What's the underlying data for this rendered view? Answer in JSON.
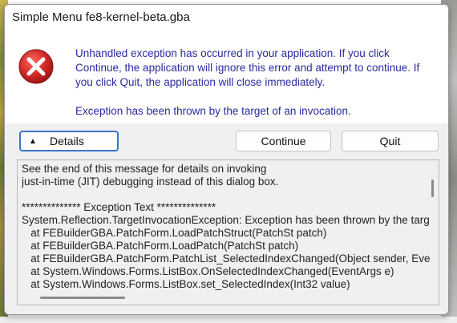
{
  "window": {
    "title": "Simple Menu fe8-kernel-beta.gba"
  },
  "message": {
    "line1": "Unhandled exception has occurred in your application. If you click Continue, the application will ignore this error and attempt to continue. If you click Quit, the application will close immediately.",
    "line2": "Exception has been thrown by the target of an invocation."
  },
  "icons": {
    "error": "error-icon",
    "details_toggle": "triangle-up-icon"
  },
  "buttons": {
    "details": "Details",
    "continue": "Continue",
    "quit": "Quit"
  },
  "details": {
    "text": "See the end of this message for details on invoking\njust-in-time (JIT) debugging instead of this dialog box.\n\n************** Exception Text **************\nSystem.Reflection.TargetInvocationException: Exception has been thrown by the targ\n   at FEBuilderGBA.PatchForm.LoadPatchStruct(PatchSt patch)\n   at FEBuilderGBA.PatchForm.LoadPatch(PatchSt patch)\n   at FEBuilderGBA.PatchForm.PatchList_SelectedIndexChanged(Object sender, Eve\n   at System.Windows.Forms.ListBox.OnSelectedIndexChanged(EventArgs e)\n   at System.Windows.Forms.ListBox.set_SelectedIndex(Int32 value)"
  },
  "colors": {
    "message_text": "#2a2aa0",
    "error_red": "#d42a2a",
    "focus_border": "#3b75c8"
  }
}
